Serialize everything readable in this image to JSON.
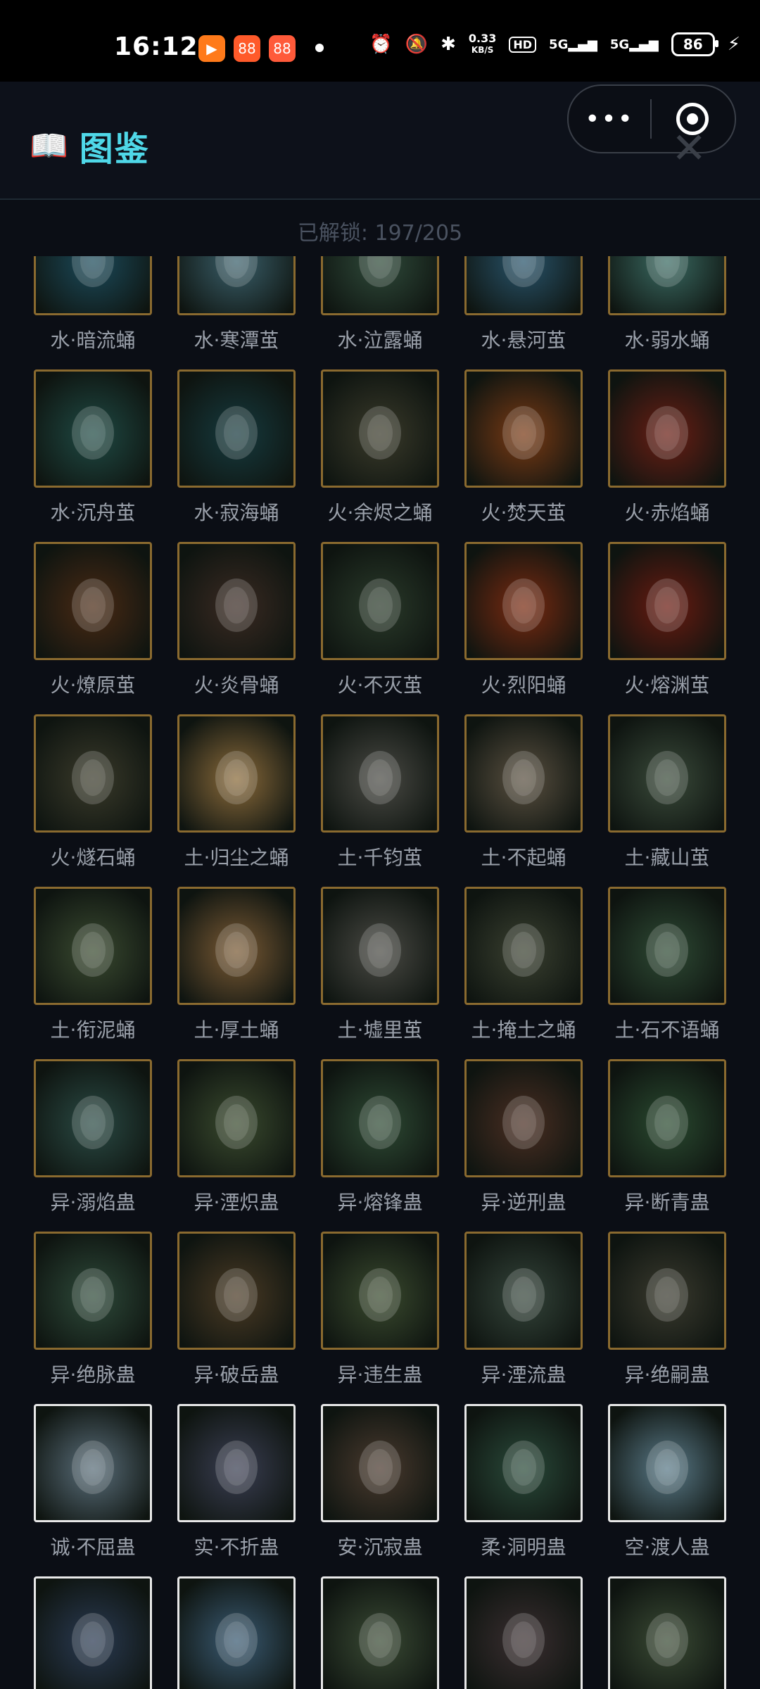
{
  "status": {
    "time": "16:12",
    "net_speed_value": "0.33",
    "net_speed_unit": "KB/S",
    "hd": "HD",
    "signal1": "5G",
    "signal2": "5G",
    "battery": "86"
  },
  "header": {
    "title": "图鉴",
    "more": "•••"
  },
  "unlocked_text": "已解锁: 197/205",
  "rows": [
    [
      {
        "name": "水·暗流蛹",
        "bg": "#1b4a5a"
      },
      {
        "name": "水·寒潭茧",
        "bg": "#3a5f6a"
      },
      {
        "name": "水·泣露蛹",
        "bg": "#2f4a3a"
      },
      {
        "name": "水·悬河茧",
        "bg": "#28536a"
      },
      {
        "name": "水·弱水蛹",
        "bg": "#3a6a62"
      }
    ],
    [
      {
        "name": "水·沉舟茧",
        "bg": "#1f4a44"
      },
      {
        "name": "水·寂海蛹",
        "bg": "#163a3e"
      },
      {
        "name": "火·余烬之蛹",
        "bg": "#3a3a2a"
      },
      {
        "name": "火·焚天茧",
        "bg": "#7a3a14"
      },
      {
        "name": "火·赤焰蛹",
        "bg": "#6a1e14"
      }
    ],
    [
      {
        "name": "火·燎原茧",
        "bg": "#4a2a14"
      },
      {
        "name": "火·炎骨蛹",
        "bg": "#3a2a22"
      },
      {
        "name": "火·不灭茧",
        "bg": "#2a3a2a"
      },
      {
        "name": "火·烈阳蛹",
        "bg": "#7a2a10"
      },
      {
        "name": "火·熔渊茧",
        "bg": "#6a1a10"
      }
    ],
    [
      {
        "name": "火·燧石蛹",
        "bg": "#3a3a2a"
      },
      {
        "name": "土·归尘之蛹",
        "bg": "#8a6a3a"
      },
      {
        "name": "土·千钧茧",
        "bg": "#4a4a44"
      },
      {
        "name": "土·不起蛹",
        "bg": "#5a5040"
      },
      {
        "name": "土·藏山茧",
        "bg": "#3a4a3a"
      }
    ],
    [
      {
        "name": "土·衔泥蛹",
        "bg": "#3a4a30"
      },
      {
        "name": "土·厚土蛹",
        "bg": "#7a5a34"
      },
      {
        "name": "土·墟里茧",
        "bg": "#4a4a44"
      },
      {
        "name": "土·掩土之蛹",
        "bg": "#3a4030"
      },
      {
        "name": "土·石不语蛹",
        "bg": "#2e4a34"
      }
    ],
    [
      {
        "name": "异·溺焰蛊",
        "bg": "#2a4a44"
      },
      {
        "name": "异·湮炽蛊",
        "bg": "#3a4a2e"
      },
      {
        "name": "异·熔锋蛊",
        "bg": "#2e4a34"
      },
      {
        "name": "异·逆刑蛊",
        "bg": "#4a2e22"
      },
      {
        "name": "异·断青蛊",
        "bg": "#2a4a30"
      }
    ],
    [
      {
        "name": "异·绝脉蛊",
        "bg": "#2e4a3a"
      },
      {
        "name": "异·破岳蛊",
        "bg": "#4a3a24"
      },
      {
        "name": "异·违生蛊",
        "bg": "#3a4a2e"
      },
      {
        "name": "异·湮流蛊",
        "bg": "#34443a"
      },
      {
        "name": "异·绝嗣蛊",
        "bg": "#3a3a2e"
      }
    ],
    [
      {
        "name": "诚·不屈蛊",
        "bg": "#5a6e7a",
        "white": true
      },
      {
        "name": "实·不折蛊",
        "bg": "#3a3e52",
        "white": true
      },
      {
        "name": "安·沉寂蛊",
        "bg": "#4a3a2e",
        "white": true
      },
      {
        "name": "柔·洞明蛊",
        "bg": "#2a4a3a",
        "white": true
      },
      {
        "name": "空·渡人蛊",
        "bg": "#5a7a88",
        "white": true
      }
    ],
    [
      {
        "name": "",
        "bg": "#2a3a52",
        "white": true
      },
      {
        "name": "",
        "bg": "#3a5a72",
        "white": true
      },
      {
        "name": "",
        "bg": "#3a4a34",
        "white": true
      },
      {
        "name": "",
        "bg": "#3a2e30",
        "white": true
      },
      {
        "name": "",
        "bg": "#3a4a34",
        "white": true
      }
    ]
  ]
}
